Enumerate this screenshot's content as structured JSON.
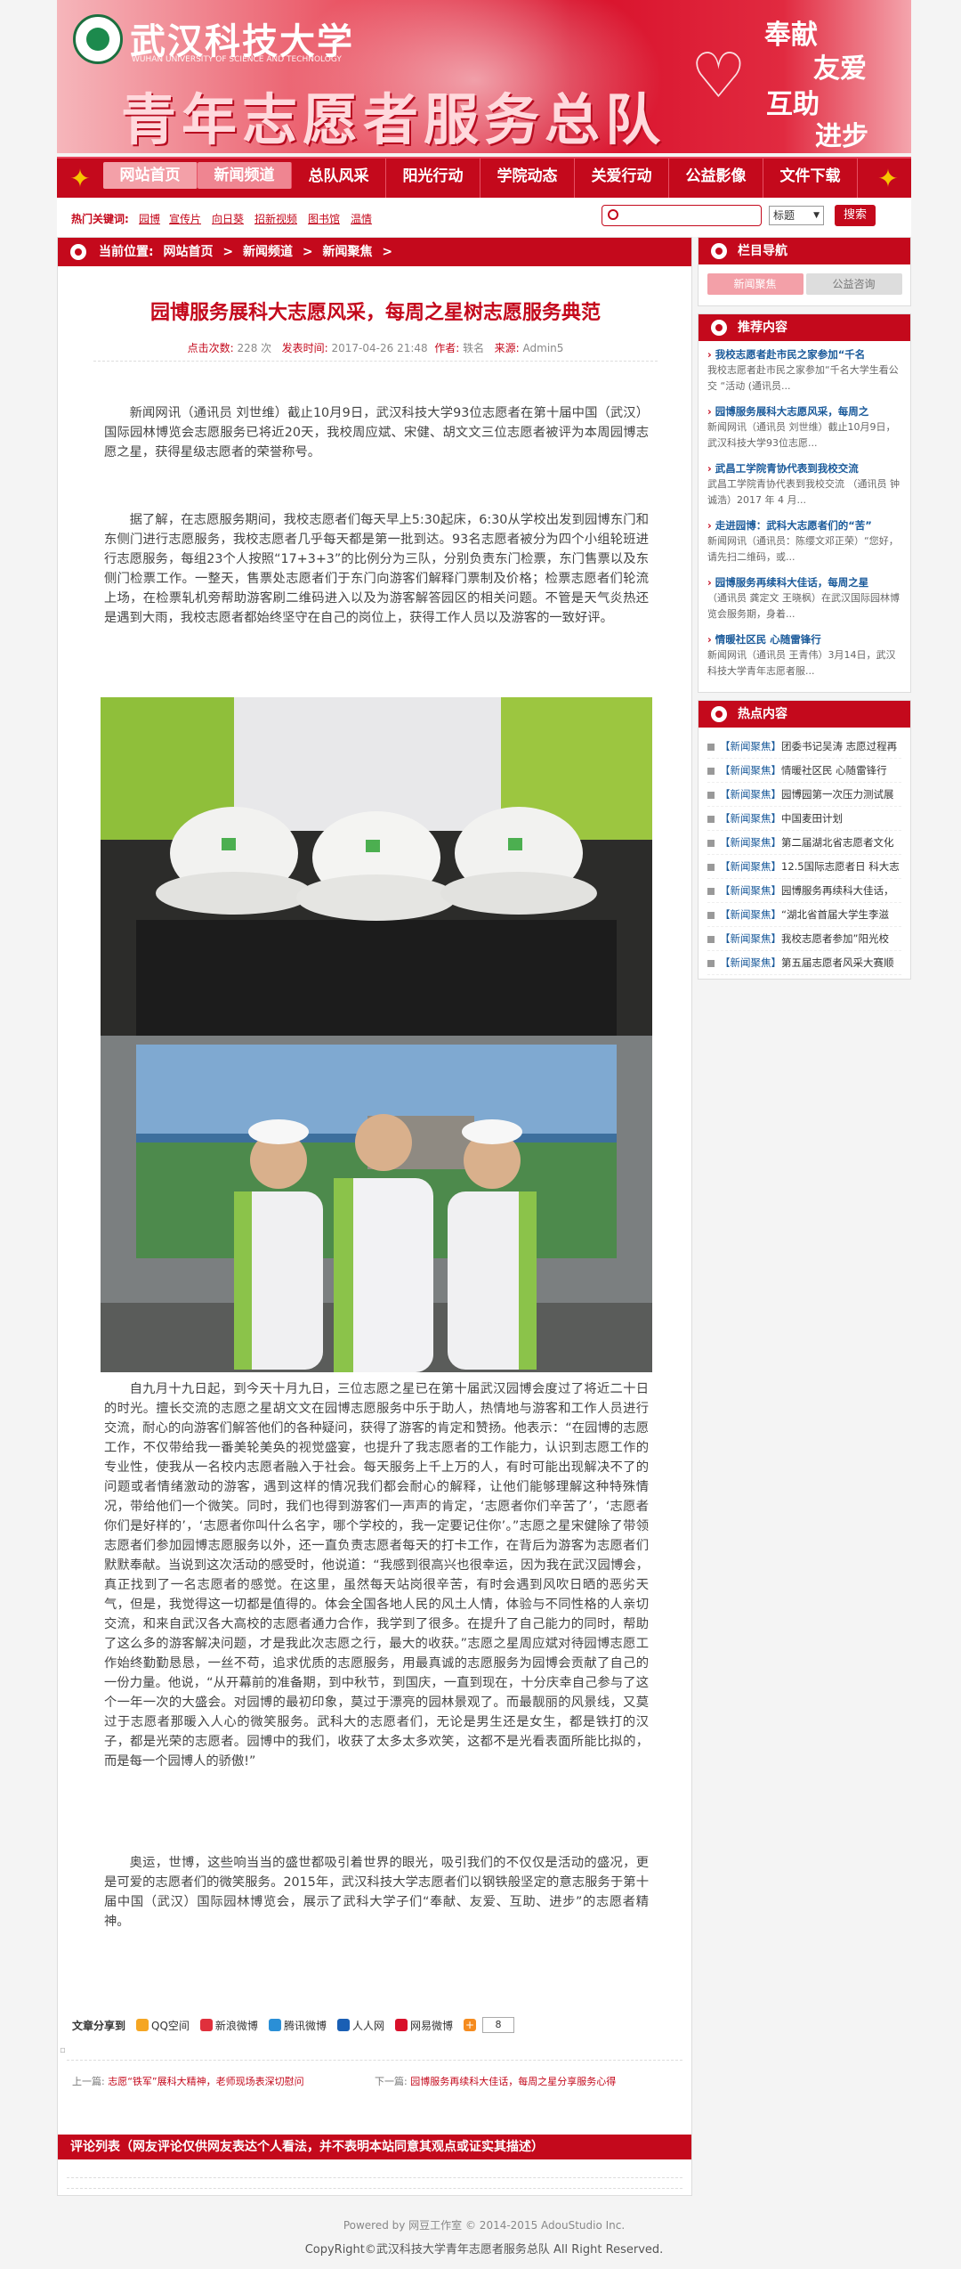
{
  "banner": {
    "school_name": "武汉科技大学",
    "school_en": "WUHAN UNIVERSITY OF SCIENCE AND TECHNOLOGY",
    "team_name": "青年志愿者服务总队",
    "motto": [
      "奉献",
      "友爱",
      "互助",
      "进步"
    ]
  },
  "nav": {
    "items": [
      "网站首页",
      "新闻频道",
      "总队风采",
      "阳光行动",
      "学院动态",
      "关爱行动",
      "公益影像",
      "文件下载"
    ]
  },
  "hotbar": {
    "label": "热门关键词:",
    "keywords": [
      "园博",
      "宣传片",
      "向日葵",
      "招新视频",
      "图书馆",
      "温情"
    ],
    "select_value": "标题",
    "search_button": "搜索"
  },
  "breadcrumb": {
    "prefix": "当前位置:",
    "items": [
      "网站首页",
      ">",
      "新闻频道",
      ">",
      "新闻聚焦",
      ">"
    ]
  },
  "article": {
    "title": "园博服务展科大志愿风采，每周之星树志愿服务典范",
    "meta": {
      "clicks_label": "点击次数:",
      "clicks_value": "228 次",
      "time_label": "发表时间:",
      "time_value": "2017-04-26 21:48",
      "author_label": "作者:",
      "author_value": "轶名",
      "source_label": "来源:",
      "source_value": "Admin5"
    },
    "p1": "新闻网讯（通讯员 刘世维）截止10月9日，武汉科技大学93位志愿者在第十届中国（武汉）国际园林博览会志愿服务已将近20天，我校周应斌、宋健、胡文文三位志愿者被评为本周园博志愿之星，获得星级志愿者的荣誉称号。",
    "p2": "据了解，在志愿服务期间，我校志愿者们每天早上5:30起床，6:30从学校出发到园博东门和东侧门进行志愿服务，我校志愿者几乎每天都是第一批到达。93名志愿者被分为四个小组轮班进行志愿服务，每组23个人按照“17+3+3”的比例分为三队，分别负责东门检票，东门售票以及东侧门检票工作。一整天，售票处志愿者们于东门向游客们解释门票制及价格；检票志愿者们轮流上场，在检票轧机旁帮助游客刷二维码进入以及为游客解答园区的相关问题。不管是天气炎热还是遇到大雨，我校志愿者都始终坚守在自己的岗位上，获得工作人员以及游客的一致好评。",
    "p3": "自九月十九日起，到今天十月九日，三位志愿之星已在第十届武汉园博会度过了将近二十日的时光。擅长交流的志愿之星胡文文在园博志愿服务中乐于助人，热情地与游客和工作人员进行交流，耐心的向游客们解答他们的各种疑问，获得了游客的肯定和赞扬。他表示：“在园博的志愿工作，不仅带给我一番美轮美奂的视觉盛宴，也提升了我志愿者的工作能力，认识到志愿工作的专业性，使我从一名校内志愿者融入于社会。每天服务上千上万的人，有时可能出现解决不了的问题或者情绪激动的游客，遇到这样的情况我们都会耐心的解释，让他们能够理解这种特殊情况，带给他们一个微笑。同时，我们也得到游客们一声声的肯定，‘志愿者你们辛苦了’，‘志愿者你们是好样的’，‘志愿者你叫什么名字，哪个学校的，我一定要记住你’。”志愿之星宋健除了带领志愿者们参加园博志愿服务以外，还一直负责志愿者每天的打卡工作，在背后为游客为志愿者们默默奉献。当说到这次活动的感受时，他说道：“我感到很高兴也很幸运，因为我在武汉园博会，真正找到了一名志愿者的感觉。在这里，虽然每天站岗很辛苦，有时会遇到风吹日晒的恶劣天气，但是，我觉得这一切都是值得的。体会全国各地人民的风土人情，体验与不同性格的人亲切交流，和来自武汉各大高校的志愿者通力合作，我学到了很多。在提升了自己能力的同时，帮助了这么多的游客解决问题，才是我此次志愿之行，最大的收获。”志愿之星周应斌对待园博志愿工作始终勤勤恳恳，一丝不苟，追求优质的志愿服务，用最真诚的志愿服务为园博会贡献了自己的一份力量。他说，“从开幕前的准备期，到中秋节，到国庆，一直到现在，十分庆幸自己参与了这个一年一次的大盛会。对园博的最初印象，莫过于漂亮的园林景观了。而最靓丽的风景线，又莫过于志愿者那暖入人心的微笑服务。武科大的志愿者们，无论是男生还是女生，都是铁打的汉子，都是光荣的志愿者。园博中的我们，收获了太多太多欢笑，这都不是光看表面所能比拟的，而是每一个园博人的骄傲!”",
    "p4": "奥运，世博，这些响当当的盛世都吸引着世界的眼光，吸引我们的不仅仅是活动的盛况，更是可爱的志愿者们的微笑服务。2015年，武汉科技大学志愿者们以钢铁般坚定的意志服务于第十届中国（武汉）国际园林博览会，展示了武科大学子们“奉献、友爱、互助、进步”的志愿者精神。"
  },
  "share": {
    "label": "文章分享到",
    "items": [
      "QQ空间",
      "新浪微博",
      "腾讯微博",
      "人人网",
      "网易微博"
    ],
    "count": "8",
    "item_colors": [
      "#f5a623",
      "#e0303c",
      "#2a8fd6",
      "#1a5fb4",
      "#d8102a"
    ]
  },
  "prev": {
    "label": "上一篇:",
    "title": "志愿“铁军”展科大精神，老师现场表深切慰问"
  },
  "next": {
    "label": "下一篇:",
    "title": "园博服务再续科大佳话，每周之星分享服务心得"
  },
  "comment": {
    "title": "评论列表（网友评论仅供网友表达个人看法，并不表明本站同意其观点或证实其描述）"
  },
  "sidebar": {
    "nav_title": "栏目导航",
    "tabs": [
      "新闻聚焦",
      "公益咨询"
    ],
    "rec_title": "推荐内容",
    "rec": [
      {
        "title": "我校志愿者赴市民之家参加“千名",
        "summary": "我校志愿者赴市民之家参加“千名大学生看公交 “活动 (通讯员..."
      },
      {
        "title": "园博服务展科大志愿风采，每周之",
        "summary": "新闻网讯（通讯员 刘世维）截止10月9日，武汉科技大学93位志愿..."
      },
      {
        "title": "武昌工学院青协代表到我校交流",
        "summary": "武昌工学院青协代表到我校交流 （通讯员 钟诚浩）2017 年 4 月..."
      },
      {
        "title": "走进园博：武科大志愿者们的“苦”",
        "summary": "新闻网讯（通讯员：陈缨文邓正荣）“您好，请先扫二维码，或..."
      },
      {
        "title": "园博服务再续科大佳话，每周之星",
        "summary": "（通讯员 龚定文 王晓枫）在武汉国际园林博览会服务期，身着..."
      },
      {
        "title": "情暖社区民 心随雷锋行",
        "summary": "新闻网讯（通讯员 王青伟）3月14日，武汉科技大学青年志愿者服..."
      }
    ],
    "hot_title": "热点内容",
    "hot_tag": "【新闻聚焦】",
    "hot": [
      "团委书记吴涛 志愿过程再",
      "情暖社区民 心随雷锋行",
      "园博园第一次压力测试展",
      "中国麦田计划",
      "第二届湖北省志愿者文化",
      "12.5国际志愿者日 科大志",
      "园博服务再续科大佳话，",
      "“湖北省首届大学生李滋",
      "我校志愿者参加”阳光校",
      "第五届志愿者风采大赛顺"
    ]
  },
  "footer": {
    "line1": "Powered by 网豆工作室 © 2014-2015 AdouStudio Inc.",
    "line2": "CopyRight©武汉科技大学青年志愿者服务总队 All Right Reserved."
  }
}
